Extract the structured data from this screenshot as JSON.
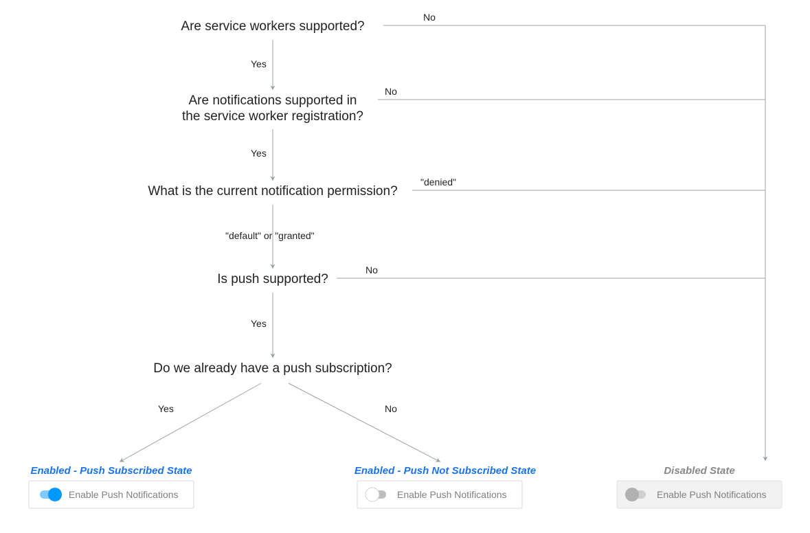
{
  "diagram": {
    "q1": "Are service workers supported?",
    "q2_line1": "Are notifications supported in",
    "q2_line2": "the service worker registration?",
    "q3": "What is the current notification permission?",
    "q4": "Is push supported?",
    "q5": "Do we already have a push subscription?",
    "edge_yes": "Yes",
    "edge_no": "No",
    "edge_default_or_granted": "\"default\" or \"granted\"",
    "edge_denied": "\"denied\"",
    "state_subscribed": "Enabled - Push Subscribed State",
    "state_not_subscribed": "Enabled - Push Not Subscribed State",
    "state_disabled": "Disabled State",
    "toggle_label": "Enable Push Notifications",
    "colors": {
      "line": "#9aa0a6",
      "card_border": "#d0d0d0",
      "toggle_on": "#0099ff",
      "toggle_on_track": "#7fc9ff",
      "toggle_off_knob": "#ffffff",
      "toggle_neutral_track": "#bdbdbd",
      "toggle_disabled_knob": "#b0b0b0",
      "toggle_disabled_track": "#cfcfcf",
      "state_label": "#1a73e8",
      "state_label_gray": "#888"
    }
  }
}
